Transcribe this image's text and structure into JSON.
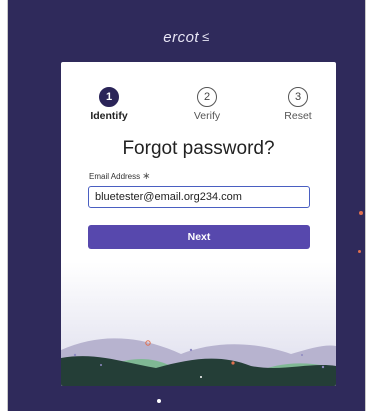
{
  "brand": {
    "name": "ercot",
    "mark": "≤"
  },
  "stepper": {
    "steps": [
      {
        "number": "1",
        "label": "Identify",
        "active": true
      },
      {
        "number": "2",
        "label": "Verify",
        "active": false
      },
      {
        "number": "3",
        "label": "Reset",
        "active": false
      }
    ]
  },
  "form": {
    "title": "Forgot password?",
    "email_label": "Email Address",
    "required_mark": "∗",
    "email_value": "bluetester@email.org234.com",
    "next_label": "Next"
  },
  "colors": {
    "background": "#2f2a5b",
    "card": "#ffffff",
    "accent": "#5748ad",
    "active_step": "#2a2458",
    "input_border": "#4a5fc1"
  },
  "icons": {
    "brand_logo": "ercot-logo-icon",
    "required": "asterisk-icon"
  }
}
